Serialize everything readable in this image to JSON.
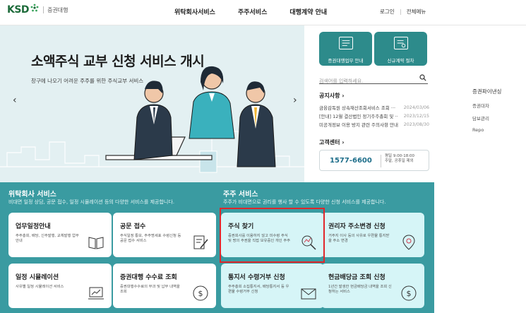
{
  "header": {
    "logo_text": "KSD",
    "logo_sub": "증권대행",
    "nav": [
      "위탁회사서비스",
      "주주서비스",
      "대행계약 안내"
    ],
    "util": [
      "로그인",
      "전체메뉴"
    ]
  },
  "hero": {
    "title": "소액주식 교부 신청 서비스 개시",
    "subtitle": "창구에 나오기 어려운 주주를 위한 주식교부 서비스",
    "prev": "‹",
    "next": "›"
  },
  "quick": [
    {
      "label": "증권대행업무 안내",
      "icon": "document-monitor-icon"
    },
    {
      "label": "신규계약 절차",
      "icon": "contract-icon"
    }
  ],
  "search": {
    "placeholder": "검색어를 입력하세요."
  },
  "notice": {
    "title": "공지사항 ›",
    "items": [
      {
        "title": "금융감독원 상속재산조회서비스 조회 ···",
        "date": "2024/03/06"
      },
      {
        "title": "[안내] 12월 결산법인 정기주주총회 및 ···",
        "date": "2023/12/15"
      },
      {
        "title": "미공개정보 이용 방지 관련 주의사항 안내",
        "date": "2023/08/30"
      }
    ]
  },
  "cs": {
    "title": "고객센터 ›",
    "phone": "1577-6600",
    "hours1": "평일 9:00-18:00",
    "hours2": "주말, 공휴일 제외"
  },
  "side_menu": {
    "title": "증권파이낸싱",
    "items": [
      "증권대차",
      "담보관리",
      "Repo"
    ]
  },
  "services": {
    "left": {
      "title": "위탁회사 서비스",
      "desc": "비대면 일정 상담, 공문 접수, 일정 시뮬레이션 등의 다양한 서비스를 제공합니다.",
      "cards": [
        {
          "title": "업무일정안내",
          "desc": "주주총회, 배당, 신주발행, 교체발행 업무안내",
          "icon": "book-icon"
        },
        {
          "title": "공문 접수",
          "desc": "주식일정 통보, 주주명세표 수령신청 등 공문 접수 서비스",
          "icon": "document-pen-icon"
        },
        {
          "title": "일정 시뮬레이션",
          "desc": "사유별 일정 시뮬레이션 서비스",
          "icon": "chart-laptop-icon"
        },
        {
          "title": "증권대행 수수료 조회",
          "desc": "증권대행수수료의 부과 및 납부 내역을 조회",
          "icon": "dollar-coin-icon"
        }
      ]
    },
    "right": {
      "title": "주주 서비스",
      "desc": "주주가 비대면으로 권리를 행사 할 수 있도록 다양한 신청 서비스를 제공합니다.",
      "cards": [
        {
          "title": "주식 찾기",
          "desc": "증권회사를 이용하지 않고 미수령 주식 및 명의 주권을 직접 보유중인 개인 주주",
          "icon": "magnifier-chart-icon"
        },
        {
          "title": "권리자 주소변경 신청",
          "desc": "거주지 이사 등의 사유로 우편물 통지받을 주소 변경",
          "icon": "location-pin-icon"
        },
        {
          "title": "통지서 수령거부 신청",
          "desc": "주주총회 소집통지서, 배당통지서 등 우편물 수령거부 신청",
          "icon": "envelope-icon"
        },
        {
          "title": "현금배당금 조회 신청",
          "desc": "1년간 발생한 현금배당금 내역을 조회 신청하는 서비스",
          "icon": "dollar-coin-icon"
        }
      ]
    }
  },
  "colors": {
    "teal": "#3a9ba1",
    "quick_teal": "#2d8b8b",
    "hero_bg": "#e3f0f2",
    "highlight": "#e0262b",
    "logo_green": "#1d6b3a"
  }
}
